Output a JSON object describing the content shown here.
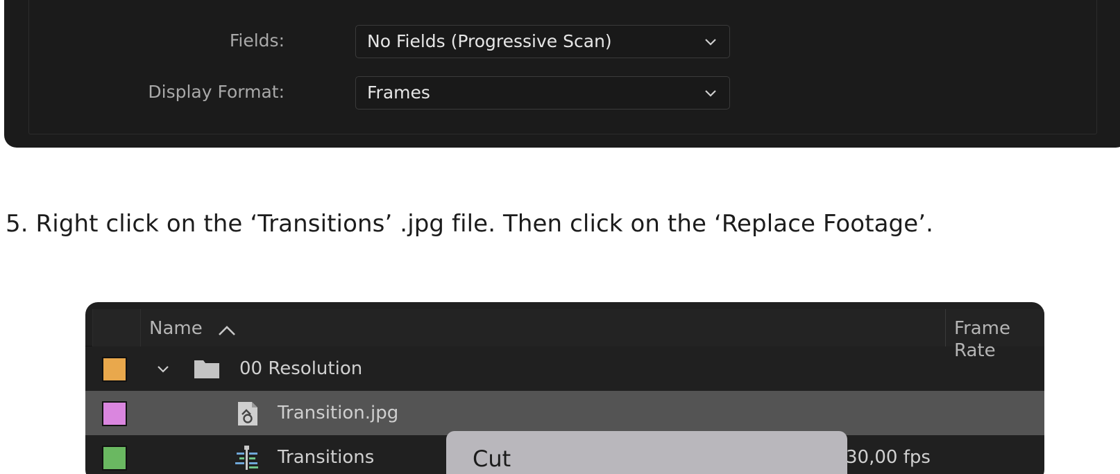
{
  "settings": {
    "fields": {
      "label": "Fields:",
      "value": "No Fields (Progressive Scan)"
    },
    "display_format": {
      "label": "Display Format:",
      "value": "Frames"
    }
  },
  "instruction": "5. Right click on the ‘Transitions’ .jpg file. Then click on the ‘Replace Footage’.",
  "project": {
    "columns": {
      "name": "Name",
      "frame_rate": "Frame Rate"
    },
    "rows": [
      {
        "name": "00 Resolution",
        "label_color": "#e9a84c",
        "frame_rate": "",
        "type": "folder",
        "expanded": true
      },
      {
        "name": "Transition.jpg",
        "label_color": "#da86df",
        "frame_rate": "",
        "type": "image",
        "selected": true
      },
      {
        "name": "Transitions",
        "label_color": "#6ab861",
        "frame_rate": "30,00 fps",
        "type": "composition"
      }
    ]
  },
  "context_menu": {
    "items": [
      "Cut"
    ]
  },
  "colors": {
    "panel_bg": "#1b1b1b",
    "selected_row": "#545454",
    "menu_bg": "#b9b7bc"
  }
}
